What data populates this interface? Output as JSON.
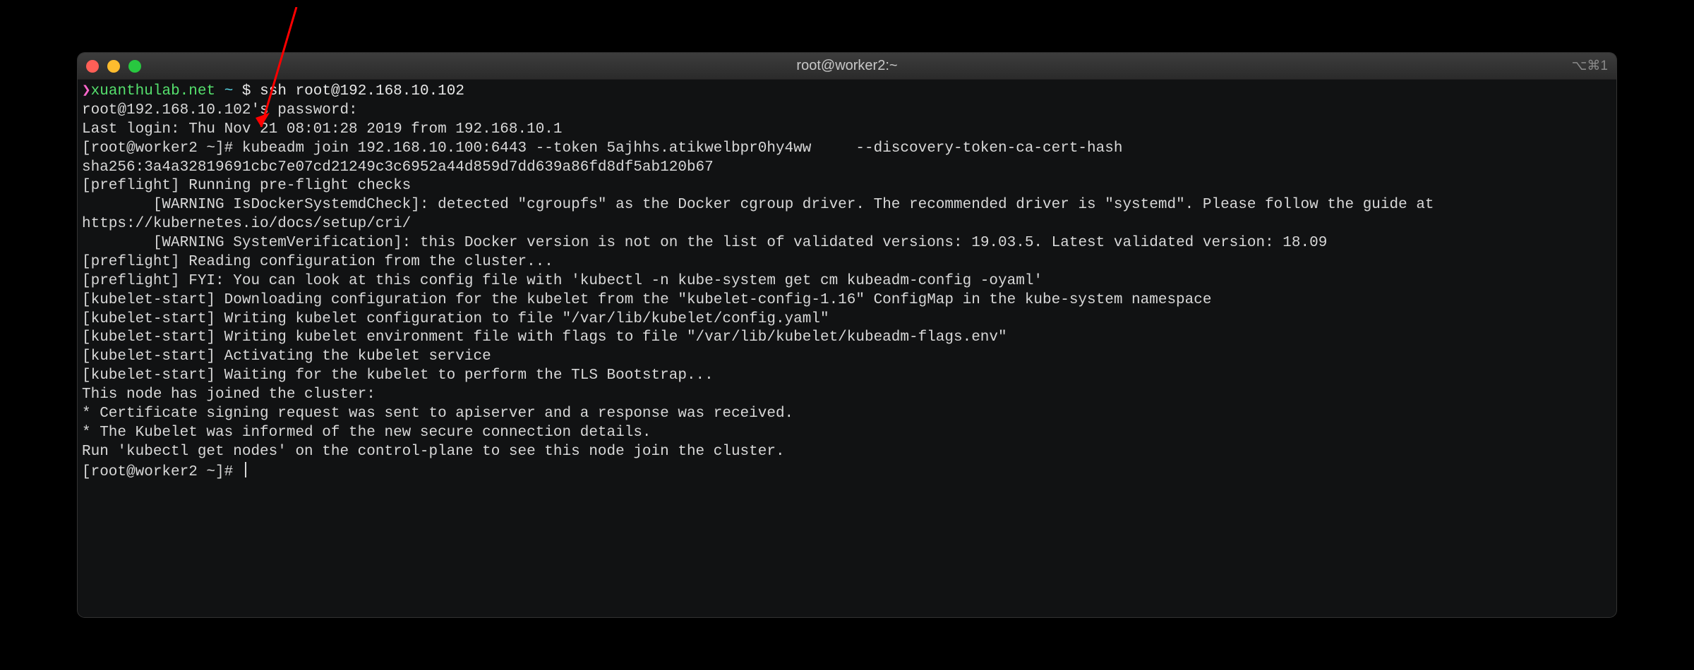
{
  "window": {
    "title": "root@worker2:~",
    "right_hint": "⌥⌘1"
  },
  "prompt": {
    "arrow": "❯",
    "host": "xuanthulab.net",
    "tilde": "~",
    "dollar": "$",
    "cmd": "ssh root@192.168.10.102"
  },
  "lines": {
    "l1": "root@192.168.10.102's password:",
    "l2": "Last login: Thu Nov 21 08:01:28 2019 from 192.168.10.1",
    "l3": "[root@worker2 ~]# kubeadm join 192.168.10.100:6443 --token 5ajhhs.atikwelbpr0hy4ww     --discovery-token-ca-cert-hash sha256:3a4a32819691cbc7e07cd21249c3c6952a44d859d7dd639a86fd8df5ab120b67",
    "l4": "[preflight] Running pre-flight checks",
    "l5": "        [WARNING IsDockerSystemdCheck]: detected \"cgroupfs\" as the Docker cgroup driver. The recommended driver is \"systemd\". Please follow the guide at https://kubernetes.io/docs/setup/cri/",
    "l6": "        [WARNING SystemVerification]: this Docker version is not on the list of validated versions: 19.03.5. Latest validated version: 18.09",
    "l7": "[preflight] Reading configuration from the cluster...",
    "l8": "[preflight] FYI: You can look at this config file with 'kubectl -n kube-system get cm kubeadm-config -oyaml'",
    "l9": "[kubelet-start] Downloading configuration for the kubelet from the \"kubelet-config-1.16\" ConfigMap in the kube-system namespace",
    "l10": "[kubelet-start] Writing kubelet configuration to file \"/var/lib/kubelet/config.yaml\"",
    "l11": "[kubelet-start] Writing kubelet environment file with flags to file \"/var/lib/kubelet/kubeadm-flags.env\"",
    "l12": "[kubelet-start] Activating the kubelet service",
    "l13": "[kubelet-start] Waiting for the kubelet to perform the TLS Bootstrap...",
    "blank1": "",
    "l14": "This node has joined the cluster:",
    "l15": "* Certificate signing request was sent to apiserver and a response was received.",
    "l16": "* The Kubelet was informed of the new secure connection details.",
    "blank2": "",
    "l17": "Run 'kubectl get nodes' on the control-plane to see this node join the cluster.",
    "blank3": "",
    "l18": "[root@worker2 ~]# "
  }
}
